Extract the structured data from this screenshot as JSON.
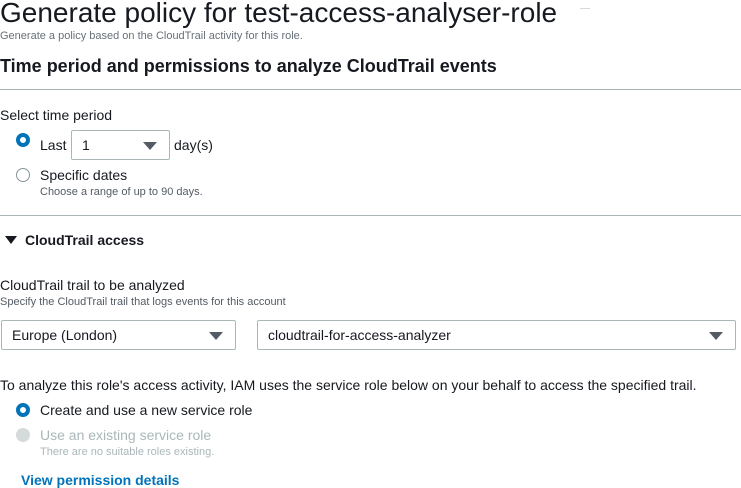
{
  "header": {
    "title": "Generate policy for test-access-analyser-role",
    "subtitle": "Generate a policy based on the CloudTrail activity for this role."
  },
  "section": {
    "heading": "Time period and permissions to analyze CloudTrail events"
  },
  "time_period": {
    "label": "Select time period",
    "last_label": "Last",
    "last_value": "1",
    "unit_label": "day(s)",
    "specific_label": "Specific dates",
    "specific_hint": "Choose a range of up to 90 days.",
    "selected": "last"
  },
  "cloudtrail": {
    "expander_label": "CloudTrail access",
    "trail_label": "CloudTrail trail to be analyzed",
    "trail_hint": "Specify the CloudTrail trail that logs events for this account",
    "region_value": "Europe (London)",
    "trail_value": "cloudtrail-for-access-analyzer"
  },
  "service_role": {
    "description": "To analyze this role's access activity, IAM uses the service role below on your behalf to access the specified trail.",
    "create_label": "Create and use a new service role",
    "existing_label": "Use an existing service role",
    "existing_hint": "There are no suitable roles existing.",
    "selected": "create"
  },
  "links": {
    "view_permission_details": "View permission details"
  },
  "colors": {
    "accent": "#0073bb",
    "text": "#16191f",
    "muted": "#545b64",
    "disabled": "#aab7b8"
  }
}
